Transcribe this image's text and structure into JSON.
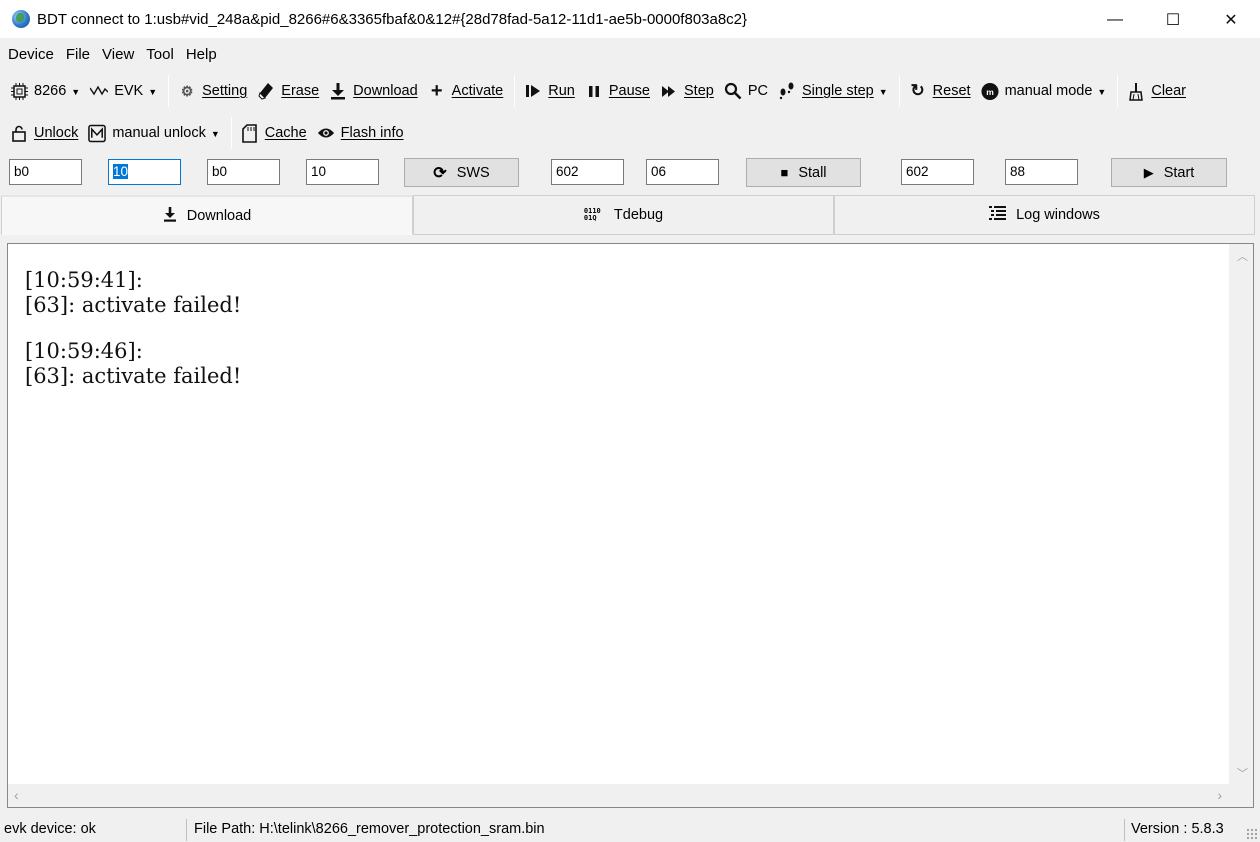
{
  "window": {
    "title": "BDT connect to 1:usb#vid_248a&pid_8266#6&3365fbaf&0&12#{28d78fad-5a12-11d1-ae5b-0000f803a8c2}",
    "minimize": "—",
    "maximize": "☐",
    "close": "✕"
  },
  "menu": [
    "Device",
    "File",
    "View",
    "Tool",
    "Help"
  ],
  "toolbar1": {
    "chip": "8266",
    "evk": "EVK",
    "setting": "Setting",
    "erase": "Erase",
    "download": "Download",
    "activate": "Activate",
    "run": "Run",
    "pause": "Pause",
    "step": "Step",
    "pc": "PC",
    "single_step": "Single step",
    "reset": "Reset",
    "manual_mode": "manual mode",
    "clear": "Clear"
  },
  "toolbar2": {
    "unlock": "Unlock",
    "manual_unlock": "manual unlock",
    "cache": "Cache",
    "flash_info": "Flash info"
  },
  "inputs": {
    "f1": "b0",
    "f2": "10",
    "f3": "b0",
    "f4": "10",
    "sws": "SWS",
    "f5": "602",
    "f6": "06",
    "stall": "Stall",
    "f7": "602",
    "f8": "88",
    "start": "Start"
  },
  "tabs": [
    "Download",
    "Tdebug",
    "Log windows"
  ],
  "log": [
    {
      "time": "[10:59:41]:",
      "msg": "[63]: activate failed!"
    },
    {
      "time": "[10:59:46]:",
      "msg": "[63]: activate failed!"
    }
  ],
  "status": {
    "device": "evk device: ok",
    "file_path": "File Path:  H:\\telink\\8266_remover_protection_sram.bin",
    "version": "Version : 5.8.3"
  },
  "icons": {
    "app": "globe-icon",
    "chip": "chip-icon",
    "evk": "wave-icon",
    "setting": "gear-icon",
    "erase": "eraser-icon",
    "download": "download-arrow-icon",
    "activate": "plus-icon",
    "run": "run-icon",
    "pause": "pause-icon",
    "step": "step-icon",
    "pc": "search-icon",
    "single_step": "footsteps-icon",
    "reset": "reset-icon",
    "manual_mode": "manual-mode-icon",
    "clear": "broom-icon",
    "unlock": "lock-icon",
    "manual_unlock": "mail-m-icon",
    "cache": "sd-card-icon",
    "flash_info": "eye-icon",
    "sws": "refresh-icon",
    "stall": "stop-icon",
    "start": "play-icon",
    "tdebug": "binary-search-icon",
    "log_windows": "list-icon"
  }
}
